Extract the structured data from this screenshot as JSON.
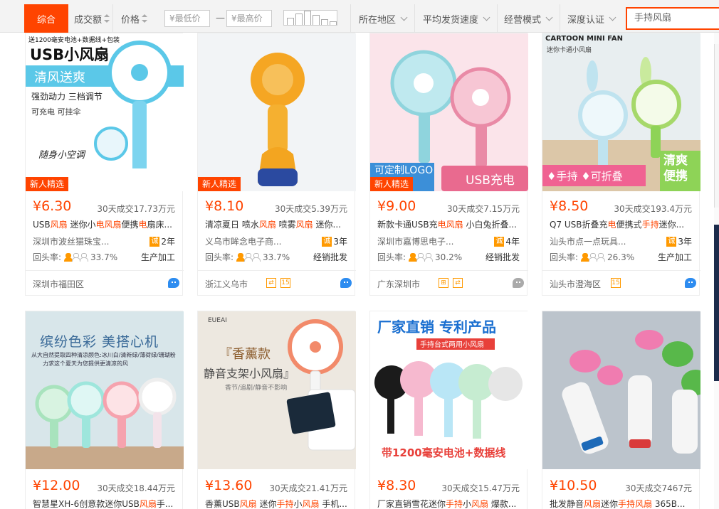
{
  "sort": {
    "comprehensive": "综合",
    "volume": "成交额",
    "price": "价格",
    "min_price": "¥最低价",
    "dash": "—",
    "max_price": "¥最高价"
  },
  "filters": {
    "location": "所在地区",
    "shipping_speed": "平均发货速度",
    "business_mode": "经营模式",
    "certification": "深度认证"
  },
  "search": {
    "placeholder": "手持风扇"
  },
  "products": [
    {
      "price": "¥6.30",
      "deal": "30天成交17.73万元",
      "title": "USB风扇 迷你小电风扇便携电扇床...",
      "shop": "深圳市波丝猫珠宝...",
      "years": "2年",
      "rate": "33.7%",
      "biz": "生产加工",
      "loc": "深圳市福田区",
      "badge": "新人精选",
      "img_text": [
        "送1200毫安电池+数据线+包装",
        "USB小风扇",
        "清风送爽",
        "强劲动力 三档调节",
        "可充电 可挂伞",
        "随身小空调"
      ],
      "colors": {
        "bg": "#ffffff",
        "accent": "#5bc8e8"
      }
    },
    {
      "price": "¥8.10",
      "deal": "30天成交5.39万元",
      "title": "清凉夏日 喷水风扇 喷雾风扇 迷你...",
      "shop": "义乌市眸念电子商...",
      "years": "3年",
      "rate": "33.7%",
      "biz": "经销批发",
      "loc": "浙江义乌市",
      "badge": "新人精选",
      "img_text": [],
      "colors": {
        "bg": "#f2f4f6",
        "accent": "#f5a623"
      }
    },
    {
      "price": "¥9.00",
      "deal": "30天成交7.15万元",
      "title": "新款卡通USB充电风扇 小白兔折叠...",
      "shop": "深圳市嘉博思电子...",
      "years": "4年",
      "rate": "30.2%",
      "biz": "经销批发",
      "loc": "广东深圳市",
      "badge": "新人精选",
      "img_text": [
        "可定制LOGO",
        "USB充电"
      ],
      "colors": {
        "bg": "#fbe4ea",
        "accent": "#e96a8f"
      }
    },
    {
      "price": "¥8.50",
      "deal": "30天成交193.4万元",
      "title": "Q7 USB折叠充电便携式手持迷你...",
      "shop": "汕头市点一点玩具...",
      "years": "3年",
      "rate": "26.3%",
      "biz": "生产加工",
      "loc": "汕头市澄海区",
      "badge": "",
      "img_text": [
        "CARTOON MINI FAN",
        "迷你卡通小风扇",
        "♦手持 ♦可折叠",
        "清爽便携"
      ],
      "colors": {
        "bg": "#e8eef0",
        "accent": "#8ed357"
      }
    },
    {
      "price": "¥12.00",
      "deal": "30天成交18.44万元",
      "title": "智慧星XH-6创意款迷你USB风扇手...",
      "img_text": [
        "缤纷色彩 美搭心机",
        "从大自然提取四种清凉颜色:冰川白/清新绿/薄荷绿/珊瑚粉",
        "力求这个夏天为您提供更清凉的风"
      ],
      "colors": {
        "bg": "#d8e6ea",
        "accent": "#6a9ab8"
      }
    },
    {
      "price": "¥13.60",
      "deal": "30天成交21.41万元",
      "title": "香薰USB风扇 迷你手持小风扇 手机...",
      "img_text": [
        "EUEAI",
        "『香薰款",
        "静音支架小风扇』",
        "香节/追剧/静音不影响"
      ],
      "colors": {
        "bg": "#ede8e0",
        "accent": "#f28a6a"
      }
    },
    {
      "price": "¥8.30",
      "deal": "30天成交15.47万元",
      "title": "厂家直销雪花迷你手持小风扇 爆款...",
      "img_text": [
        "厂家直销 专利产品",
        "手持台式两用小风扇",
        "带1200毫安电池+数据线"
      ],
      "colors": {
        "bg": "#ffffff",
        "accent": "#1a6fd0"
      }
    },
    {
      "price": "¥10.50",
      "deal": "30天成交7467元",
      "title": "批发静音风扇迷你手持风扇 365B...",
      "img_text": [],
      "colors": {
        "bg": "#bcc4cc",
        "accent": "#f07cb0"
      }
    }
  ],
  "labels": {
    "rate_label": "回头率:"
  },
  "colors": {
    "accent": "#ff4400",
    "toolbar_bg": "#f3f3f3"
  }
}
